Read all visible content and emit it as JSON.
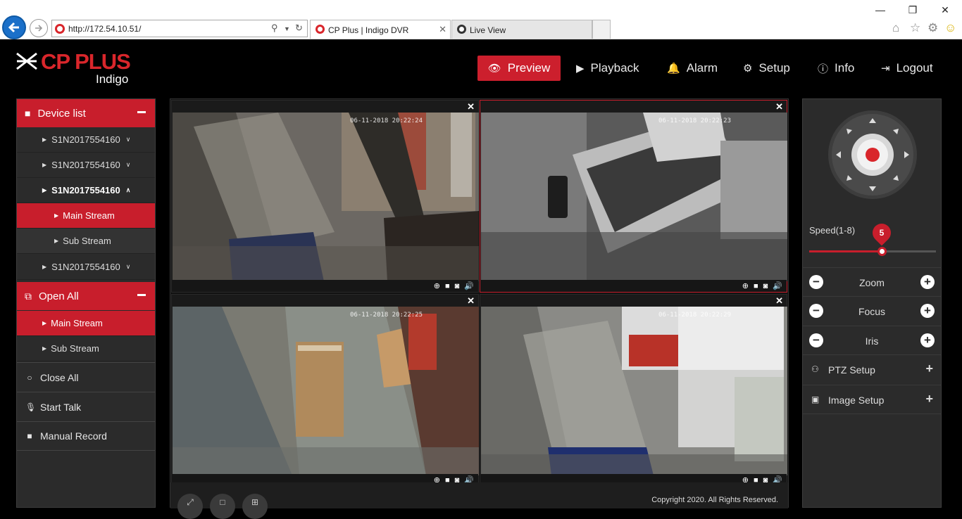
{
  "browser": {
    "url": "http://172.54.10.51/",
    "tabs": [
      {
        "label": "CP Plus | Indigo DVR",
        "active": true
      },
      {
        "label": "Live View",
        "active": false
      }
    ],
    "window_buttons": [
      "—",
      "❐",
      "✕"
    ]
  },
  "app": {
    "brand": "CP PLUS",
    "product": "Indigo",
    "accent": "#cc1f2d",
    "nav": [
      {
        "label": "Preview",
        "icon": "eye-icon",
        "active": true
      },
      {
        "label": "Playback",
        "icon": "play-icon"
      },
      {
        "label": "Alarm",
        "icon": "bell-icon"
      },
      {
        "label": "Setup",
        "icon": "gear-icon"
      },
      {
        "label": "Info",
        "icon": "info-icon"
      },
      {
        "label": "Logout",
        "icon": "logout-icon"
      }
    ]
  },
  "left": {
    "device_list_label": "Device list",
    "devices": [
      {
        "label": "S1N2017554160",
        "expanded": false
      },
      {
        "label": "S1N2017554160",
        "expanded": false
      },
      {
        "label": "S1N2017554160",
        "expanded": true
      },
      {
        "label": "S1N2017554160",
        "expanded": false
      }
    ],
    "device_streams": {
      "main": "Main Stream",
      "sub": "Sub Stream"
    },
    "open_all_label": "Open All",
    "open_all_streams": {
      "main": "Main Stream",
      "sub": "Sub Stream"
    },
    "close_all_label": "Close All",
    "start_talk_label": "Start Talk",
    "manual_record_label": "Manual Record"
  },
  "grid": {
    "panes": [
      {
        "timestamp": "06-11-2018 20:22:24"
      },
      {
        "timestamp": "06-11-2018 20:22:23"
      },
      {
        "timestamp": "06-11-2018 20:22:25"
      },
      {
        "timestamp": "06-11-2018 20:22:29"
      }
    ],
    "copyright": "Copyright 2020. All Rights Reserved."
  },
  "right": {
    "speed_label": "Speed(1-8)",
    "speed_value": "5",
    "speed_min": 1,
    "speed_max": 8,
    "zoom_label": "Zoom",
    "focus_label": "Focus",
    "iris_label": "Iris",
    "ptz_setup_label": "PTZ Setup",
    "image_setup_label": "Image Setup"
  }
}
